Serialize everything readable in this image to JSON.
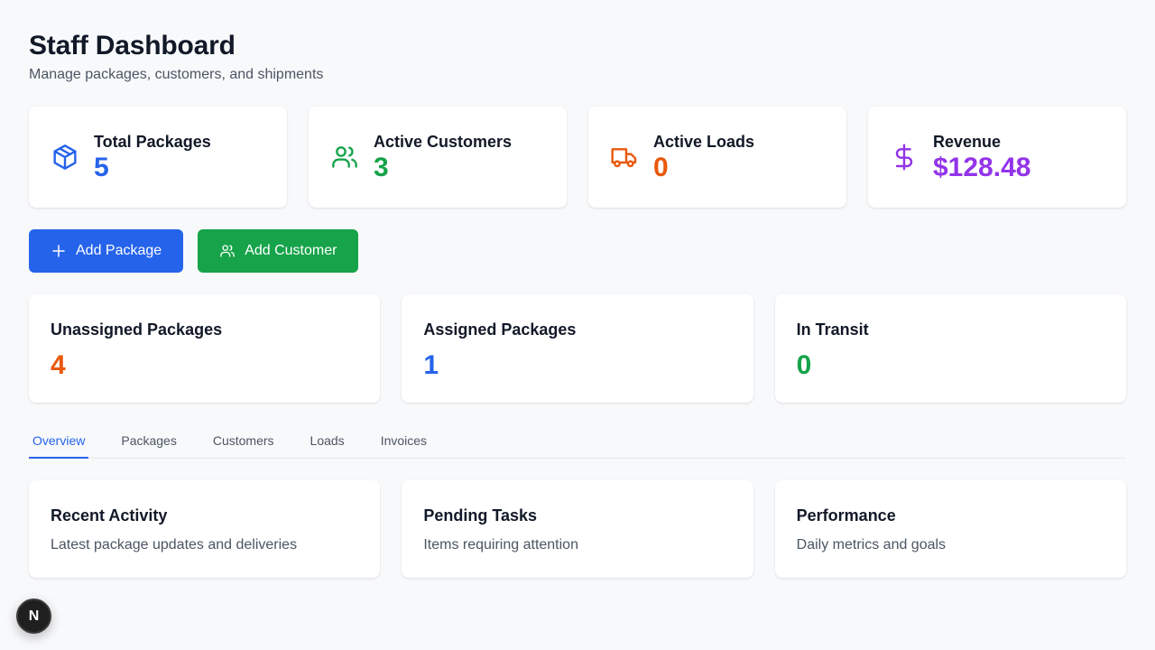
{
  "header": {
    "title": "Staff Dashboard",
    "subtitle": "Manage packages, customers, and shipments"
  },
  "stats": [
    {
      "label": "Total Packages",
      "value": "5",
      "icon": "package-icon",
      "color": "#2563eb"
    },
    {
      "label": "Active Customers",
      "value": "3",
      "icon": "users-icon",
      "color": "#16a34a"
    },
    {
      "label": "Active Loads",
      "value": "0",
      "icon": "truck-icon",
      "color": "#ea580c"
    },
    {
      "label": "Revenue",
      "value": "$128.48",
      "icon": "dollar-icon",
      "color": "#9333ea"
    }
  ],
  "actions": {
    "add_package": "Add Package",
    "add_customer": "Add Customer"
  },
  "summary": [
    {
      "label": "Unassigned Packages",
      "value": "4",
      "color": "#ea580c"
    },
    {
      "label": "Assigned Packages",
      "value": "1",
      "color": "#2563eb"
    },
    {
      "label": "In Transit",
      "value": "0",
      "color": "#16a34a"
    }
  ],
  "tabs": [
    {
      "label": "Overview",
      "active": true
    },
    {
      "label": "Packages",
      "active": false
    },
    {
      "label": "Customers",
      "active": false
    },
    {
      "label": "Loads",
      "active": false
    },
    {
      "label": "Invoices",
      "active": false
    }
  ],
  "panels": [
    {
      "title": "Recent Activity",
      "description": "Latest package updates and deliveries"
    },
    {
      "title": "Pending Tasks",
      "description": "Items requiring attention"
    },
    {
      "title": "Performance",
      "description": "Daily metrics and goals"
    }
  ],
  "dev_badge": {
    "label": "N",
    "icon": "nextjs-logo-icon"
  }
}
